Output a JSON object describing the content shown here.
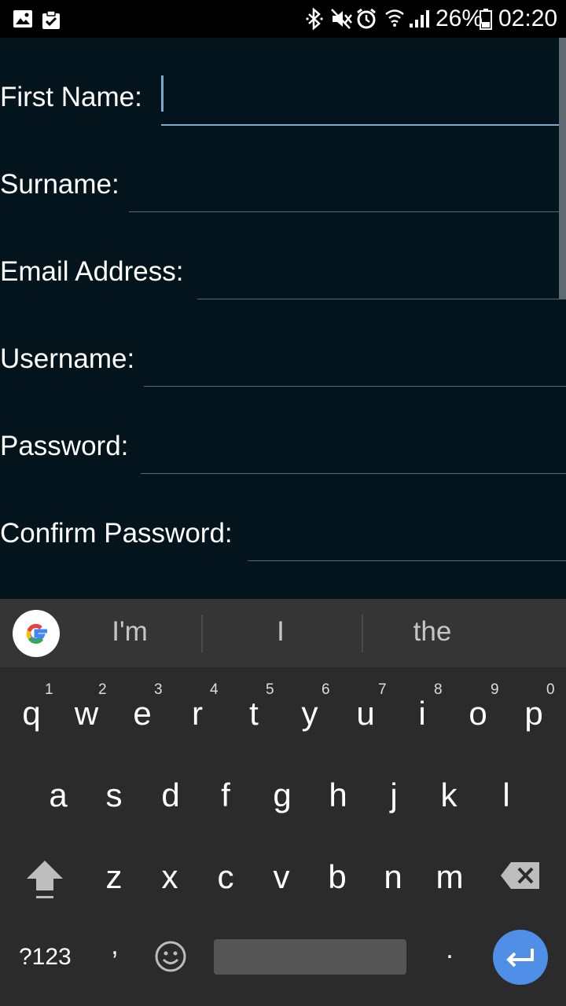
{
  "status_bar": {
    "battery_percent": "26%",
    "time": "02:20",
    "icons": [
      "gallery-icon",
      "clipboard-check-icon",
      "bluetooth-icon",
      "mute-icon",
      "alarm-icon",
      "wifi-icon",
      "signal-icon",
      "battery-icon"
    ]
  },
  "form": {
    "fields": [
      {
        "label": "First Name:",
        "value": ""
      },
      {
        "label": "Surname:",
        "value": ""
      },
      {
        "label": "Email Address:",
        "value": ""
      },
      {
        "label": "Username:",
        "value": ""
      },
      {
        "label": "Password:",
        "value": ""
      },
      {
        "label": "Confirm Password:",
        "value": ""
      }
    ]
  },
  "keyboard": {
    "suggestions": [
      "I'm",
      "I",
      "the"
    ],
    "row1": [
      {
        "key": "q",
        "num": "1"
      },
      {
        "key": "w",
        "num": "2"
      },
      {
        "key": "e",
        "num": "3"
      },
      {
        "key": "r",
        "num": "4"
      },
      {
        "key": "t",
        "num": "5"
      },
      {
        "key": "y",
        "num": "6"
      },
      {
        "key": "u",
        "num": "7"
      },
      {
        "key": "i",
        "num": "8"
      },
      {
        "key": "o",
        "num": "9"
      },
      {
        "key": "p",
        "num": "0"
      }
    ],
    "row2": [
      "a",
      "s",
      "d",
      "f",
      "g",
      "h",
      "j",
      "k",
      "l"
    ],
    "row3": [
      "z",
      "x",
      "c",
      "v",
      "b",
      "n",
      "m"
    ],
    "symbols_label": "?123",
    "comma": ",",
    "period": "."
  }
}
